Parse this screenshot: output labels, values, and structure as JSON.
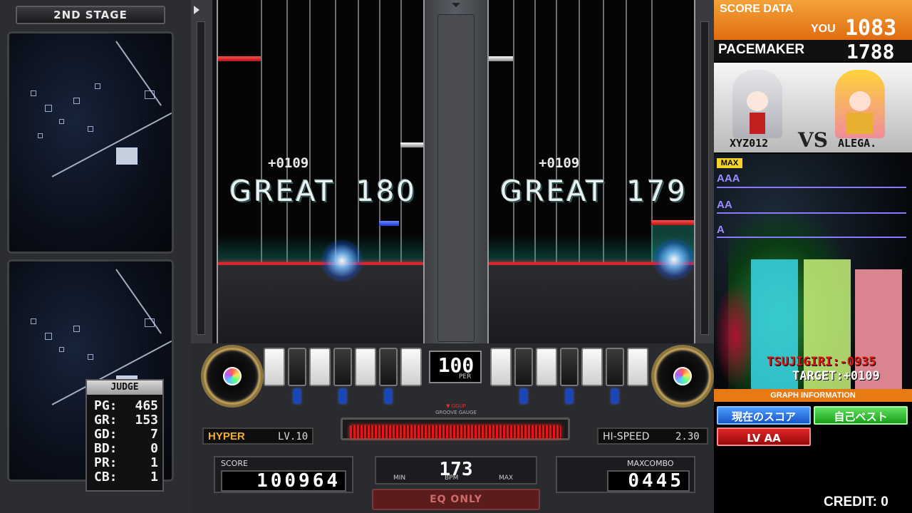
{
  "stage": {
    "label": "2ND STAGE"
  },
  "judge": {
    "title": "JUDGE",
    "rows": [
      {
        "label": "PG:",
        "value": "465"
      },
      {
        "label": "GR:",
        "value": "153"
      },
      {
        "label": "GD:",
        "value": "7"
      },
      {
        "label": "BD:",
        "value": "0"
      },
      {
        "label": "PR:",
        "value": "1"
      },
      {
        "label": "CB:",
        "value": "1"
      }
    ]
  },
  "player1": {
    "timing": "+0109",
    "judgement": "GREAT",
    "combo": "180"
  },
  "player2": {
    "timing": "+0109",
    "judgement": "GREAT",
    "combo": "179"
  },
  "per": {
    "value": "100",
    "label": "PER"
  },
  "groove_gauge": {
    "label_top": "▼ GGUP",
    "label_bottom": "GROOVE GAUGE",
    "fill_percent": 100,
    "color": "#e01818"
  },
  "difficulty": {
    "name": "HYPER",
    "level": "LV.10"
  },
  "hispeed": {
    "label": "HI-SPEED",
    "value": "2.30"
  },
  "score": {
    "label": "SCORE",
    "value": "100964"
  },
  "bpm": {
    "value": "173",
    "min_label": "MIN",
    "label": "BPM",
    "max_label": "MAX"
  },
  "maxcombo": {
    "label": "MAXCOMBO",
    "value": "0445"
  },
  "eq_only": {
    "label": "EQ ONLY"
  },
  "score_data": {
    "title": "SCORE DATA",
    "you_label": "YOU",
    "you_value": "1083",
    "pacemaker_label": "PACEMAKER",
    "pacemaker_value": "1788"
  },
  "versus": {
    "left_name": "XYZ012",
    "vs": "VS",
    "right_name": "ALEGA."
  },
  "graph": {
    "max_label": "MAX",
    "grades": [
      "AAA",
      "AA",
      "A"
    ],
    "bars": [
      {
        "name": "current",
        "color": "#3ad6e6",
        "ratio": 0.55
      },
      {
        "name": "best",
        "color": "#c8f07a",
        "ratio": 0.55
      },
      {
        "name": "target",
        "color": "#ff9aa6",
        "ratio": 0.51
      }
    ],
    "tsujigiri": "TSUJIGIRI:-0935",
    "target": "TARGET:+0109"
  },
  "graph_info": {
    "title": "GRAPH INFORMATION",
    "current_score_button": "現在のスコア",
    "personal_best_button": "自己ベスト",
    "level_button": "LV AA"
  },
  "credit": "CREDIT: 0",
  "colors": {
    "accent_orange": "#e87a14",
    "judgeline_red": "#d8262a",
    "gauge_red": "#e01818"
  }
}
